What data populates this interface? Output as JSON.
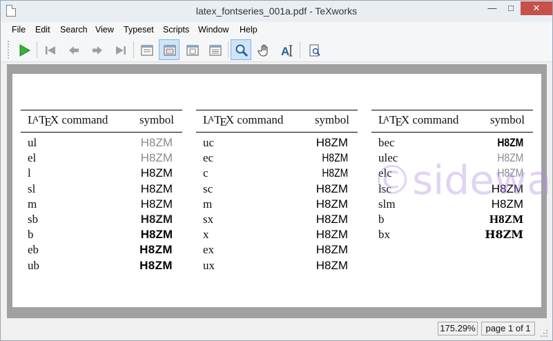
{
  "window": {
    "title": "latex_fontseries_001a.pdf - TeXworks"
  },
  "window_controls": {
    "minimize": "—",
    "maximize": "□",
    "close": "✕"
  },
  "menu": [
    "File",
    "Edit",
    "Search",
    "View",
    "Typeset",
    "Scripts",
    "Window",
    "Help"
  ],
  "toolbar": {
    "buttons": [
      "typeset-icon",
      "first-page-icon",
      "previous-page-icon",
      "next-page-icon",
      "last-page-icon",
      "actual-size-icon",
      "fit-width-icon",
      "fit-window-icon",
      "continuous-scroll-icon",
      "magnify-icon",
      "hand-icon",
      "text-select-icon",
      "goto-source-icon"
    ],
    "active": [
      "fit-width-icon",
      "magnify-icon"
    ],
    "accent": "#2e9e2e"
  },
  "document": {
    "header_cmd_word": "command",
    "header_symbol": "symbol",
    "tables": [
      {
        "rows": [
          {
            "cmd": "ul",
            "sym": "H8ZM",
            "weight": "w-elight"
          },
          {
            "cmd": "el",
            "sym": "H8ZM",
            "weight": "w-light"
          },
          {
            "cmd": "l",
            "sym": "H8ZM",
            "weight": ""
          },
          {
            "cmd": "sl",
            "sym": "H8ZM",
            "weight": ""
          },
          {
            "cmd": "m",
            "sym": "H8ZM",
            "weight": ""
          },
          {
            "cmd": "sb",
            "sym": "H8ZM",
            "weight": "w-semi"
          },
          {
            "cmd": "b",
            "sym": "H8ZM",
            "weight": "w-bold"
          },
          {
            "cmd": "eb",
            "sym": "H8ZM",
            "weight": "w-heavy"
          },
          {
            "cmd": "ub",
            "sym": "H8ZM",
            "weight": "w-heavy"
          }
        ]
      },
      {
        "rows": [
          {
            "cmd": "uc",
            "sym": "H8ZM",
            "weight": ""
          },
          {
            "cmd": "ec",
            "sym": "H8ZM",
            "weight": "cond"
          },
          {
            "cmd": "c",
            "sym": "H8ZM",
            "weight": "cond"
          },
          {
            "cmd": "sc",
            "sym": "H8ZM",
            "weight": ""
          },
          {
            "cmd": "m",
            "sym": "H8ZM",
            "weight": ""
          },
          {
            "cmd": "sx",
            "sym": "H8ZM",
            "weight": ""
          },
          {
            "cmd": "x",
            "sym": "H8ZM",
            "weight": ""
          },
          {
            "cmd": "ex",
            "sym": "H8ZM",
            "weight": ""
          },
          {
            "cmd": "ux",
            "sym": "H8ZM",
            "weight": ""
          }
        ]
      },
      {
        "rows": [
          {
            "cmd": "bec",
            "sym": "H8ZM",
            "weight": "w-bold cond"
          },
          {
            "cmd": "ulec",
            "sym": "H8ZM",
            "weight": "w-elight cond"
          },
          {
            "cmd": "elc",
            "sym": "H8ZM",
            "weight": "w-light cond"
          },
          {
            "cmd": "lsc",
            "sym": "H8ZM",
            "weight": ""
          },
          {
            "cmd": "slm",
            "sym": "H8ZM",
            "weight": ""
          },
          {
            "cmd": "b",
            "sym": "H8ZM",
            "weight": "serif-b"
          },
          {
            "cmd": "bx",
            "sym": "H8ZM",
            "weight": "ser-bx"
          }
        ]
      }
    ]
  },
  "watermark": "©sideway",
  "status": {
    "zoom": "175.29%",
    "page": "page 1 of 1"
  }
}
